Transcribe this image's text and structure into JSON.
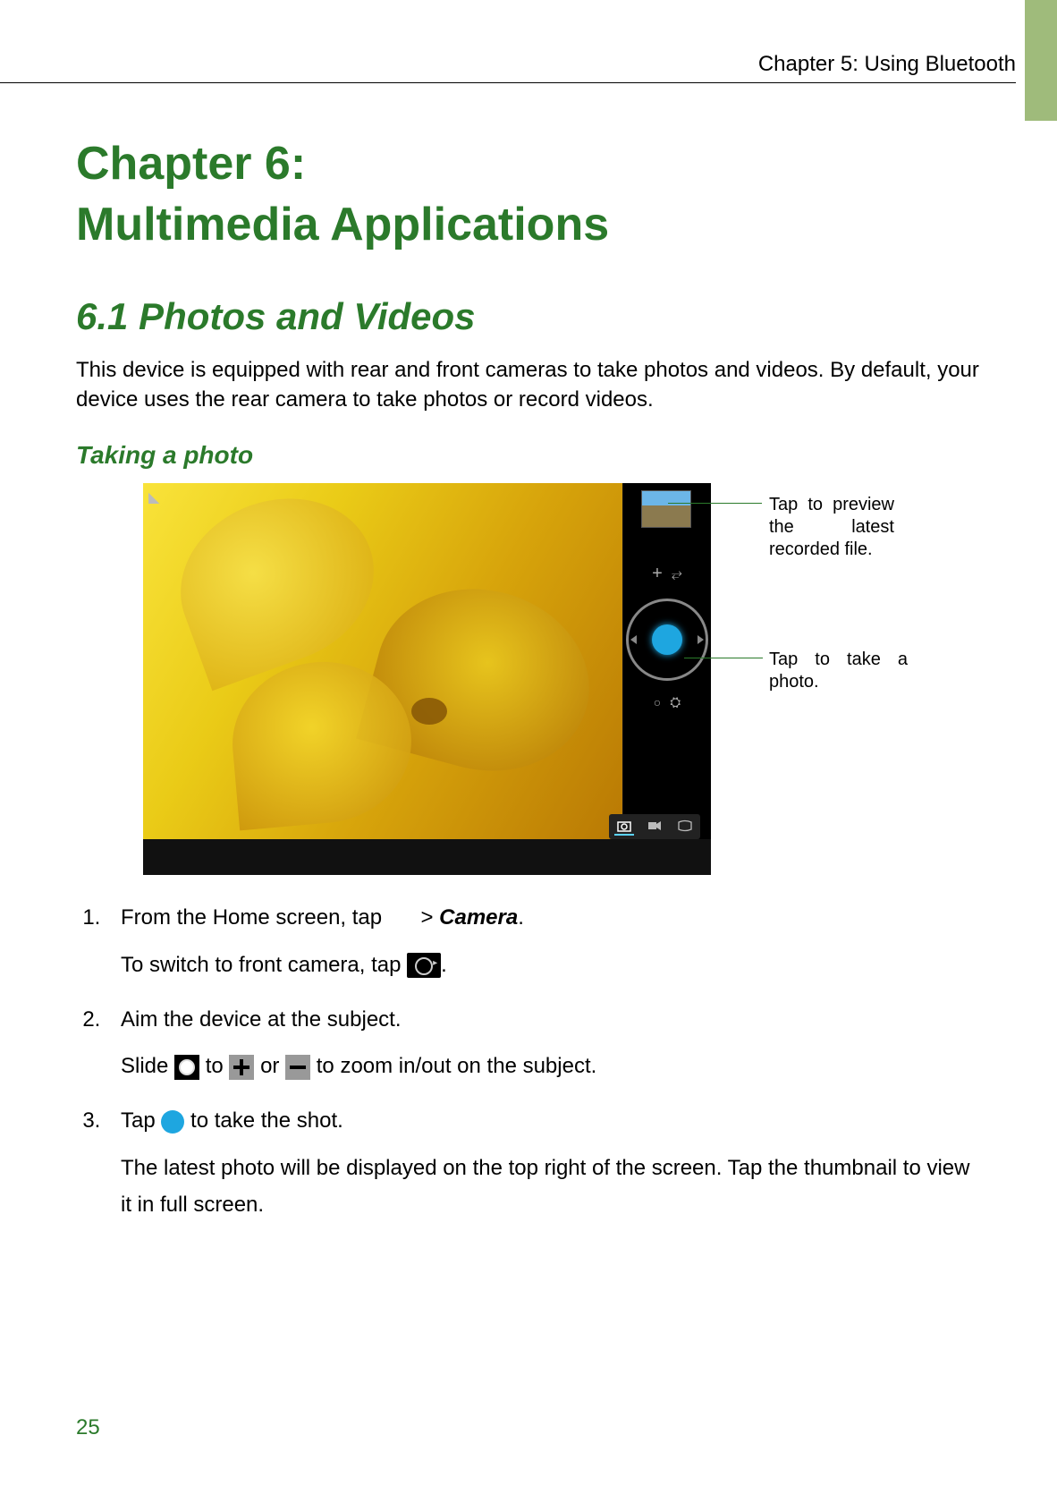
{
  "header": {
    "running_head": "Chapter 5: Using Bluetooth"
  },
  "chapter_title_line1": "Chapter 6:",
  "chapter_title_line2": "Multimedia Applications",
  "section_title": "6.1 Photos and Videos",
  "intro_paragraph": "This device is equipped with rear and front cameras to take photos and videos. By default, your device uses the rear camera to take photos or record videos.",
  "subheading": "Taking a photo",
  "screenshot": {
    "callouts": {
      "preview": "Tap to preview the latest recorded file.",
      "shutter": "Tap to take a photo."
    },
    "controls": {
      "plus": "+",
      "switch_glyph": "⇄",
      "minus": "○",
      "extra_glyph": "⚙"
    }
  },
  "steps": {
    "s1_a": "From the Home screen, tap ",
    "s1_b": " > ",
    "s1_camera": "Camera",
    "s1_c": ".",
    "s1_sub": "To switch to front camera, tap ",
    "s2_a": "Aim the device at the subject.",
    "s2_sub_a": "Slide ",
    "s2_sub_b": " to ",
    "s2_sub_c": " or ",
    "s2_sub_d": " to zoom in/out on the subject.",
    "s3_a": "Tap ",
    "s3_b": " to take the shot.",
    "s3_sub": "The latest photo will be displayed on the top right of the screen. Tap the thumbnail to view it in full screen."
  },
  "page_number": "25"
}
